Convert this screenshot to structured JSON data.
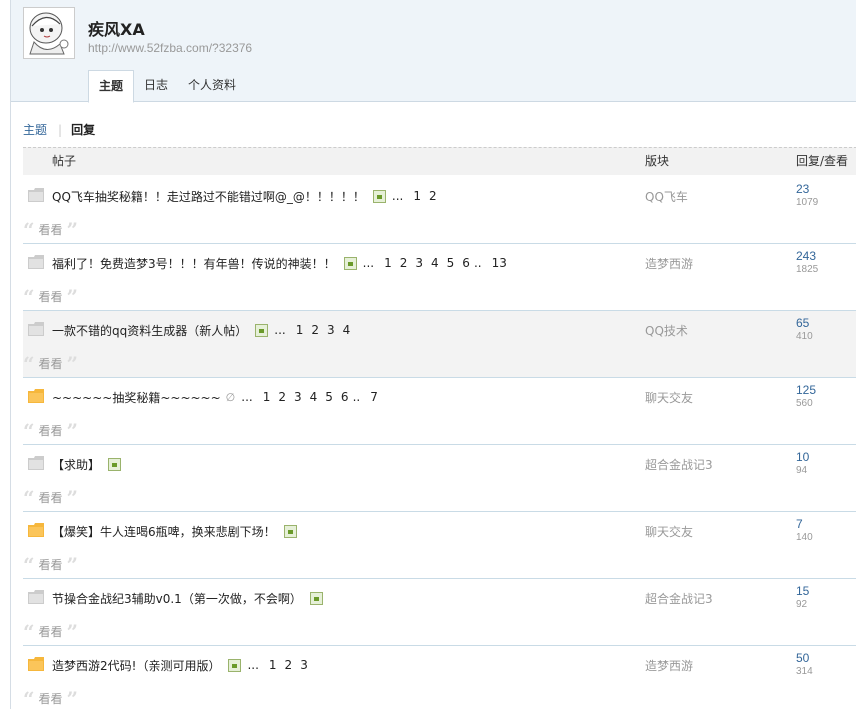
{
  "profile": {
    "name": "疾风XA",
    "url": "http://www.52fzba.com/?32376"
  },
  "tabs": [
    {
      "label": "主题",
      "active": true
    },
    {
      "label": "日志",
      "active": false
    },
    {
      "label": "个人资料",
      "active": false
    }
  ],
  "subnav": {
    "topics": "主题",
    "replies": "回复"
  },
  "table": {
    "headers": {
      "title": "帖子",
      "forum": "版块",
      "replies": "回复/查看"
    },
    "rows": [
      {
        "icon": "gray",
        "title": "QQ飞车抽奖秘籍！！走过路过不能错过啊@_@！！！！！",
        "img": true,
        "clip": false,
        "pages": [
          "...",
          "1",
          "2"
        ],
        "forum": "QQ飞车",
        "replies": "23",
        "views": "1079",
        "quote": "看看",
        "highlight": false
      },
      {
        "icon": "gray",
        "title": "福利了！免费造梦3号！！！有年兽！传说的神装！！",
        "img": true,
        "clip": false,
        "pages": [
          "...",
          "1",
          "2",
          "3",
          "4",
          "5",
          "6",
          "..",
          "13"
        ],
        "forum": "造梦西游",
        "replies": "243",
        "views": "1825",
        "quote": "看看",
        "highlight": false
      },
      {
        "icon": "gray",
        "title": "一款不错的qq资料生成器（新人帖）",
        "img": true,
        "clip": false,
        "pages": [
          "...",
          "1",
          "2",
          "3",
          "4"
        ],
        "forum": "QQ技术",
        "replies": "65",
        "views": "410",
        "quote": "看看",
        "highlight": true
      },
      {
        "icon": "orange",
        "title": "~~~~~~抽奖秘籍~~~~~~",
        "img": false,
        "clip": true,
        "pages": [
          "...",
          "1",
          "2",
          "3",
          "4",
          "5",
          "6",
          "..",
          "7"
        ],
        "forum": "聊天交友",
        "replies": "125",
        "views": "560",
        "quote": "看看",
        "highlight": false
      },
      {
        "icon": "gray",
        "title": "【求助】",
        "img": true,
        "clip": false,
        "pages": [],
        "forum": "超合金战记3",
        "replies": "10",
        "views": "94",
        "quote": "看看",
        "highlight": false
      },
      {
        "icon": "orange",
        "title": "【爆笑】牛人连喝6瓶啤，换来悲剧下场！",
        "img": true,
        "clip": false,
        "pages": [],
        "forum": "聊天交友",
        "replies": "7",
        "views": "140",
        "quote": "看看",
        "highlight": false
      },
      {
        "icon": "gray",
        "title": "节操合金战纪3辅助v0.1（第一次做，不会啊）",
        "img": true,
        "clip": false,
        "pages": [],
        "forum": "超合金战记3",
        "replies": "15",
        "views": "92",
        "quote": "看看",
        "highlight": false
      },
      {
        "icon": "orange",
        "title": "造梦西游2代码!（亲测可用版）",
        "img": true,
        "clip": false,
        "pages": [
          "...",
          "1",
          "2",
          "3"
        ],
        "forum": "造梦西游",
        "replies": "50",
        "views": "314",
        "quote": "看看",
        "highlight": false
      }
    ]
  },
  "colors": {
    "link": "#336699",
    "header_bg": "#eef4f9",
    "row_border": "#c9dbe6",
    "folder_orange": "#f6b73c",
    "folder_gray": "#cccccc"
  }
}
